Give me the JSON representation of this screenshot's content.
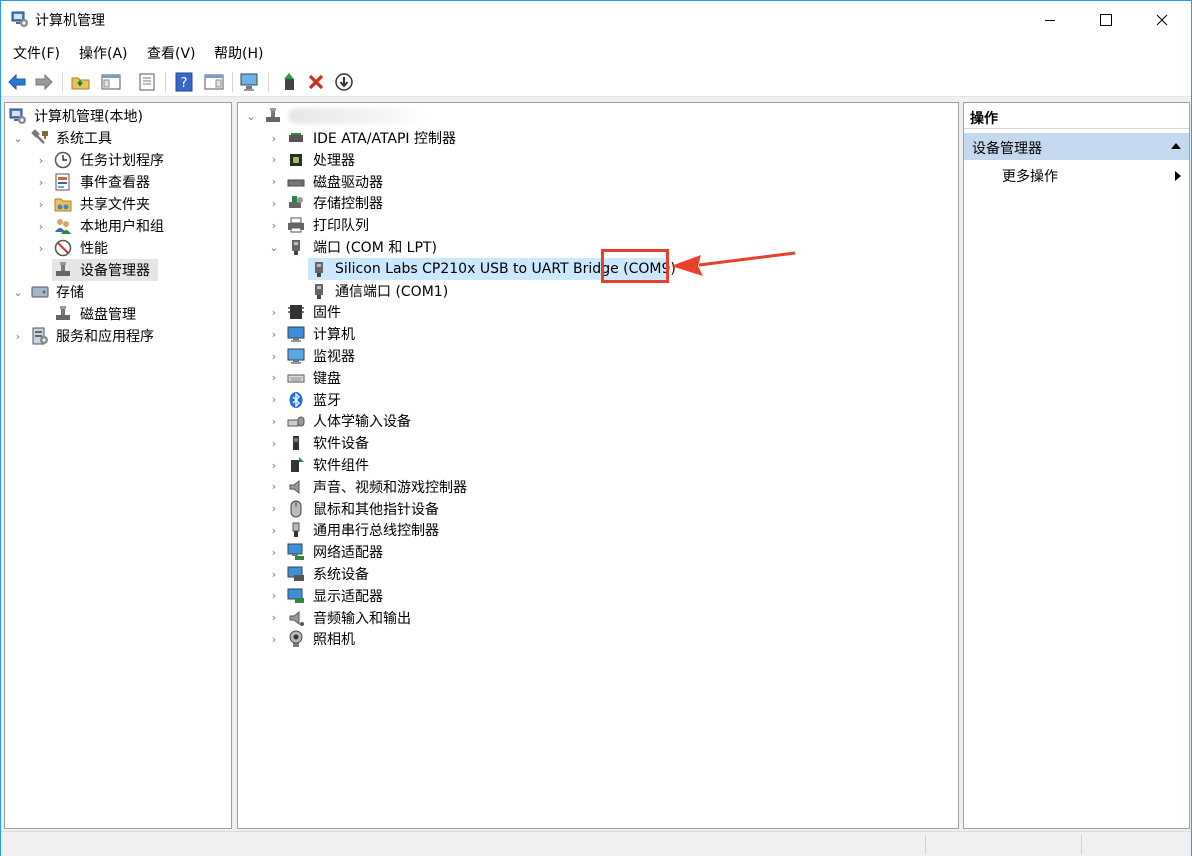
{
  "window": {
    "title": "计算机管理"
  },
  "menubar": [
    "文件(F)",
    "操作(A)",
    "查看(V)",
    "帮助(H)"
  ],
  "left_tree": {
    "root": "计算机管理(本地)",
    "system_tools": "系统工具",
    "task_scheduler": "任务计划程序",
    "event_viewer": "事件查看器",
    "shared_folders": "共享文件夹",
    "local_users": "本地用户和组",
    "performance": "性能",
    "device_manager": "设备管理器",
    "storage": "存储",
    "disk_management": "磁盘管理",
    "services_apps": "服务和应用程序"
  },
  "device_tree": {
    "computer_name_blurred": "",
    "categories": [
      {
        "label": "IDE ATA/ATAPI 控制器",
        "icon": "ide-controller-icon"
      },
      {
        "label": "处理器",
        "icon": "processor-icon"
      },
      {
        "label": "磁盘驱动器",
        "icon": "disk-drive-icon"
      },
      {
        "label": "存储控制器",
        "icon": "storage-controller-icon"
      },
      {
        "label": "打印队列",
        "icon": "printer-icon"
      },
      {
        "label": "端口 (COM 和 LPT)",
        "icon": "port-icon",
        "expanded": true,
        "children": [
          {
            "label": "Silicon Labs CP210x USB to UART Bridge (COM9)",
            "selected": true,
            "highlight": "(COM9)"
          },
          {
            "label": "通信端口 (COM1)"
          }
        ]
      },
      {
        "label": "固件",
        "icon": "firmware-icon"
      },
      {
        "label": "计算机",
        "icon": "computer-icon"
      },
      {
        "label": "监视器",
        "icon": "monitor-icon"
      },
      {
        "label": "键盘",
        "icon": "keyboard-icon"
      },
      {
        "label": "蓝牙",
        "icon": "bluetooth-icon"
      },
      {
        "label": "人体学输入设备",
        "icon": "hid-icon"
      },
      {
        "label": "软件设备",
        "icon": "software-device-icon"
      },
      {
        "label": "软件组件",
        "icon": "software-component-icon"
      },
      {
        "label": "声音、视频和游戏控制器",
        "icon": "sound-icon"
      },
      {
        "label": "鼠标和其他指针设备",
        "icon": "mouse-icon"
      },
      {
        "label": "通用串行总线控制器",
        "icon": "usb-icon"
      },
      {
        "label": "网络适配器",
        "icon": "network-adapter-icon"
      },
      {
        "label": "系统设备",
        "icon": "system-device-icon"
      },
      {
        "label": "显示适配器",
        "icon": "display-adapter-icon"
      },
      {
        "label": "音频输入和输出",
        "icon": "audio-io-icon"
      },
      {
        "label": "照相机",
        "icon": "camera-icon"
      }
    ]
  },
  "actions": {
    "header": "操作",
    "section": "设备管理器",
    "more": "更多操作"
  },
  "colors": {
    "selection": "#cce8ff",
    "titlebar": "#ffffff",
    "accent": "#2b9af3",
    "annotation_red": "#e8402a",
    "action_section": "#c4d9ef"
  }
}
